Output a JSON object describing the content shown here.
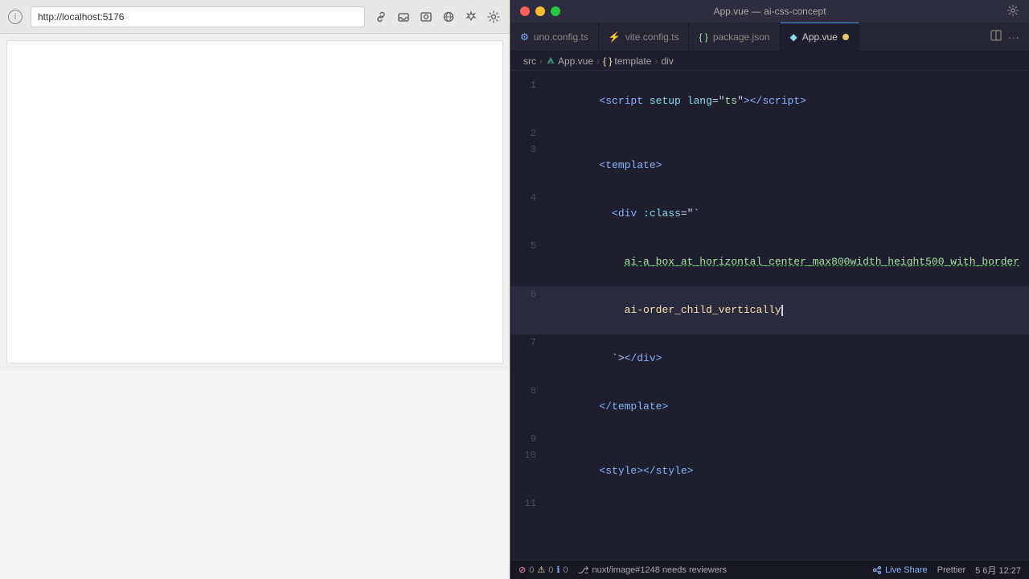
{
  "browser": {
    "address": "http://localhost:5176",
    "info_icon": "i"
  },
  "titlebar": {
    "title": "App.vue — ai-css-concept"
  },
  "tabs": [
    {
      "id": "uno-config",
      "label": "uno.config.ts",
      "icon": "⚙",
      "active": false
    },
    {
      "id": "vite-config",
      "label": "vite.config.ts",
      "icon": "⚡",
      "active": false
    },
    {
      "id": "package-json",
      "label": "package.json",
      "icon": "📦",
      "active": false
    },
    {
      "id": "app-vue",
      "label": "App.vue",
      "icon": "◆",
      "active": true,
      "modified": true
    }
  ],
  "breadcrumb": {
    "src": "src",
    "file": "App.vue",
    "template": "template",
    "div": "div"
  },
  "code_lines": [
    {
      "num": 1,
      "content": "<script setup lang=\"ts\"></script>",
      "type": "tag"
    },
    {
      "num": 2,
      "content": "",
      "type": "empty"
    },
    {
      "num": 3,
      "content": "<template>",
      "type": "tag"
    },
    {
      "num": 4,
      "content": "  <div :class=\"`",
      "type": "tag"
    },
    {
      "num": 5,
      "content": "    ai-a_box_at_horizontal_center_max800width_height500_with_border",
      "type": "classval",
      "underline": true
    },
    {
      "num": 6,
      "content": "    ai-order_child_vertically",
      "type": "classval",
      "active": true,
      "cursor_after": true
    },
    {
      "num": 7,
      "content": "  `\"></div>",
      "type": "tag"
    },
    {
      "num": 8,
      "content": "</template>",
      "type": "tag"
    },
    {
      "num": 9,
      "content": "",
      "type": "empty"
    },
    {
      "num": 10,
      "content": "<style></style>",
      "type": "tag"
    },
    {
      "num": 11,
      "content": "",
      "type": "empty"
    }
  ],
  "statusbar": {
    "git_branch": "nuxt/image#1248 needs reviewers",
    "errors": 0,
    "warnings": 0,
    "info": 0,
    "live_share": "Live Share",
    "prettier": "Prettier",
    "encoding": "5 6月 12:27",
    "line_col": "5 6月 12:27"
  }
}
